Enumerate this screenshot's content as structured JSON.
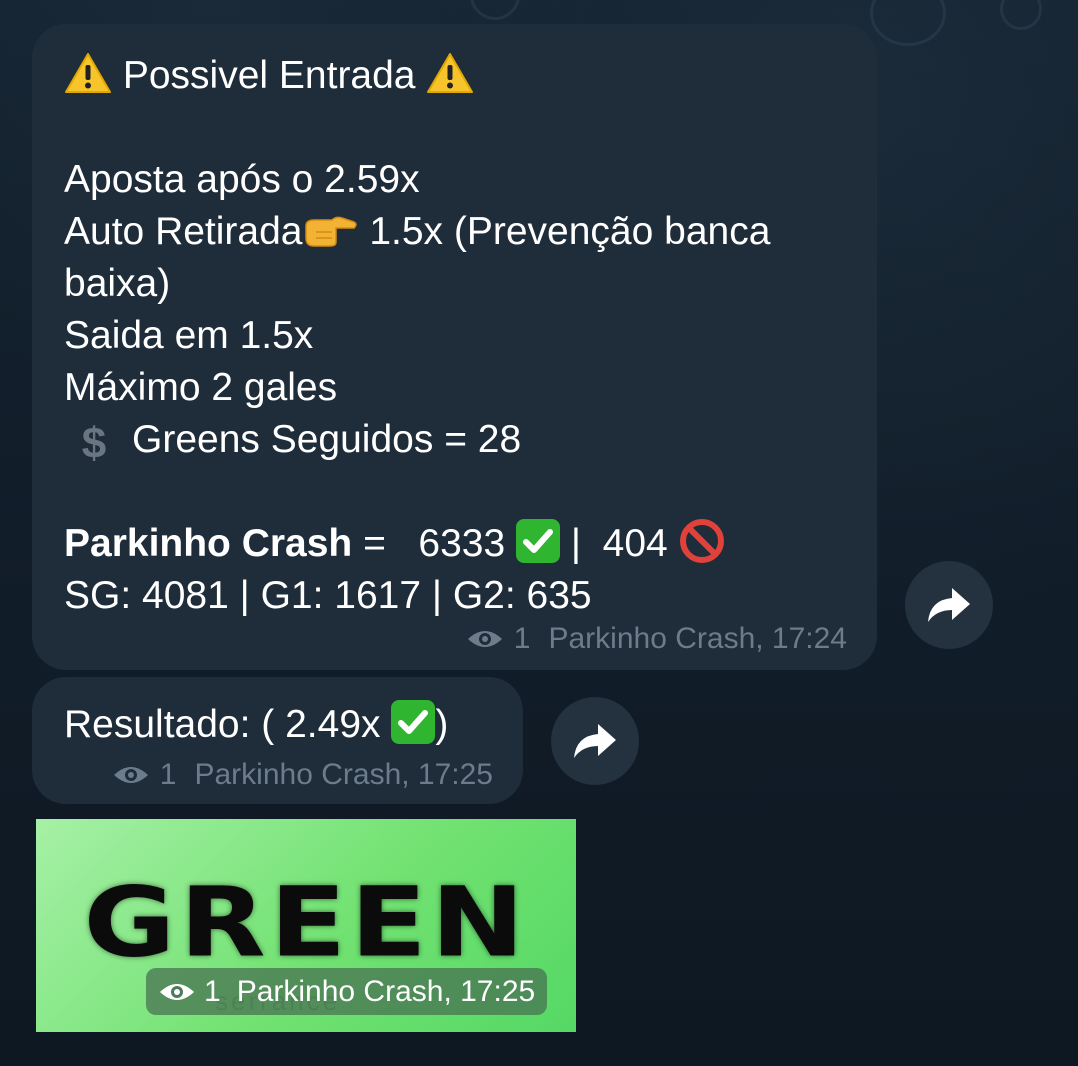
{
  "messages": [
    {
      "title": "Possivel Entrada",
      "lines": [
        "Aposta após o 2.59x",
        "Auto Retirada",
        "1.5x (Prevenção banca",
        "baixa)",
        "Saida em 1.5x",
        "Máximo 2 gales",
        "Greens Seguidos = 28"
      ],
      "stats_label": "Parkinho Crash",
      "stats_eq": " =   ",
      "stats_wins": "6333",
      "stats_sep": " |  ",
      "stats_losses": "404",
      "gales_line": "SG: 4081 | G1: 1617 | G2: 635",
      "views": "1",
      "signature": "Parkinho Crash, 17:24"
    },
    {
      "text_before": "Resultado: ( 2.49x",
      "text_after": ")",
      "views": "1",
      "signature": "Parkinho Crash, 17:25"
    },
    {
      "image_word": "GREEN",
      "image_faint": "serrance",
      "views": "1",
      "signature": "Parkinho Crash, 17:25"
    }
  ],
  "icons": {
    "warning": "warning-icon",
    "pointing": "backhand-index-pointing-right-icon",
    "dollar": "heavy-dollar-sign-icon",
    "check": "check-mark-button-icon",
    "no_entry": "prohibited-icon",
    "eye": "eye-icon",
    "share": "share-arrow-icon"
  },
  "colors": {
    "background": "#0f1a24",
    "bubble": "#1f2c39",
    "meta_text": "#6d7c8a",
    "check_green": "#2fb52f",
    "image_green": "#72e272"
  }
}
